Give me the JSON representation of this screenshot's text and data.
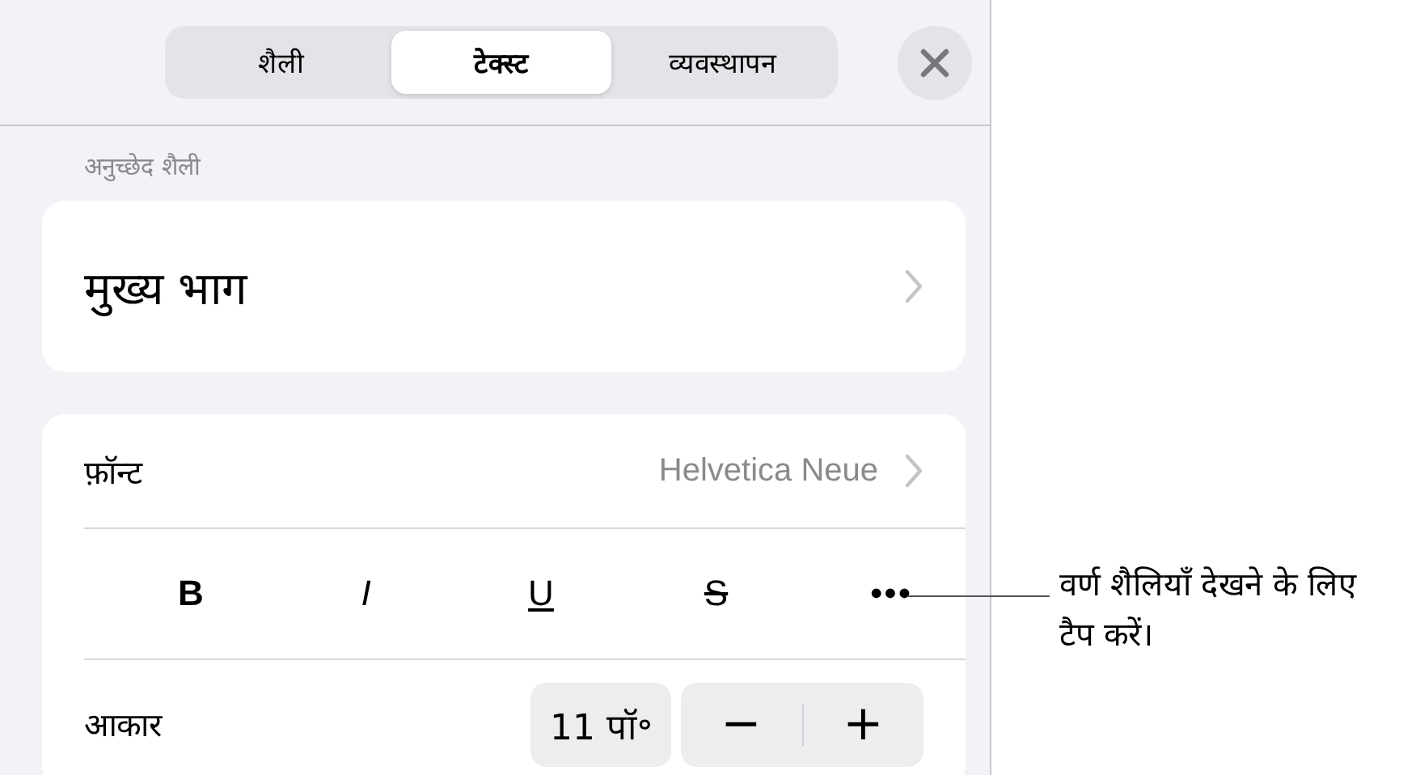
{
  "tabs": [
    {
      "label": "शैली",
      "selected": false
    },
    {
      "label": "टेक्स्ट",
      "selected": true
    },
    {
      "label": "व्यवस्थापन",
      "selected": false
    }
  ],
  "paragraph_style": {
    "heading": "अनुच्छेद शैली",
    "value": "मुख्य भाग"
  },
  "font": {
    "label": "फ़ॉन्ट",
    "value": "Helvetica Neue"
  },
  "format_buttons": [
    {
      "label": "B",
      "kind": "bold"
    },
    {
      "label": "I",
      "kind": "italic"
    },
    {
      "label": "U",
      "kind": "underline"
    },
    {
      "label": "S",
      "kind": "strike"
    },
    {
      "label": "•••",
      "kind": "more"
    }
  ],
  "size": {
    "label": "आकार",
    "value": "11 पॉ॰",
    "decrease": "−",
    "increase": "+"
  },
  "callout": "वर्ण शैलियाँ देखने के लिए टैप करें।"
}
